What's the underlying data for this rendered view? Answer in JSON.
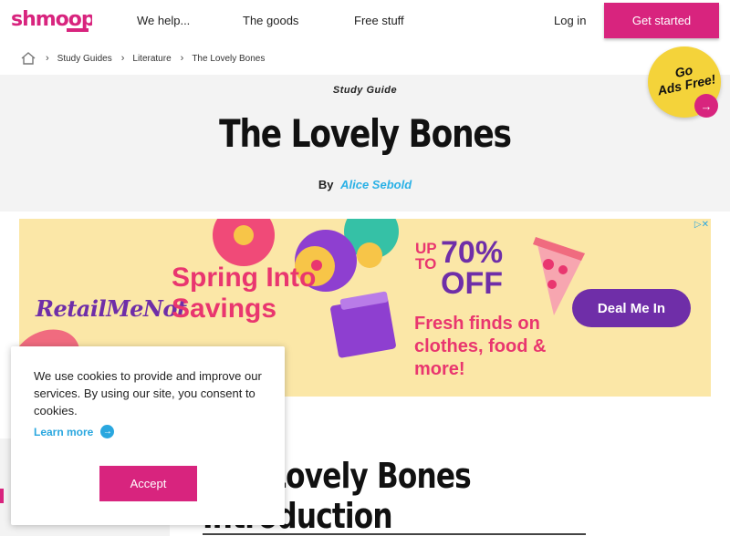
{
  "nav": {
    "logo_text": "shmoop",
    "we_help": "We help...",
    "the_goods": "The goods",
    "free_stuff": "Free stuff",
    "log_in": "Log in",
    "get_started": "Get started"
  },
  "breadcrumb": {
    "items": [
      "Study Guides",
      "Literature",
      "The Lovely Bones"
    ]
  },
  "hero": {
    "kicker": "Study Guide",
    "title": "The Lovely Bones",
    "by": "By",
    "author": "Alice Sebold"
  },
  "ads_free": {
    "line1": "Go",
    "line2": "Ads Free!"
  },
  "ad": {
    "brand": "RetailMeNot",
    "headline": "Spring Into Savings",
    "offer_prefix": "UP TO",
    "offer_amount": "70% OFF",
    "subtext": "Fresh finds on clothes, food & more!",
    "cta": "Deal Me In"
  },
  "article": {
    "title_line1": "The Lovely Bones",
    "title_line2": "Introduction"
  },
  "cookie": {
    "message": "We use cookies to provide and improve our services. By using our site, you consent to cookies.",
    "learn_more": "Learn more",
    "accept": "Accept"
  },
  "colors": {
    "brand_pink": "#d8247e",
    "link_blue": "#2aa7df",
    "ad_purple": "#6f2ea8",
    "ad_bg": "#fbe7a7"
  }
}
